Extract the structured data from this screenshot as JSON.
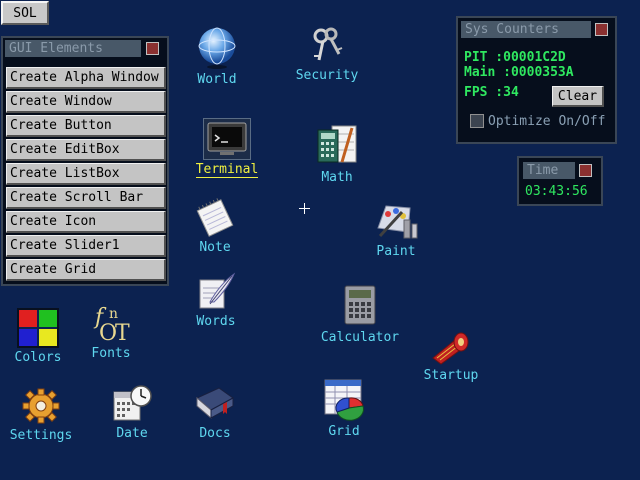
{
  "start_button": {
    "label": "SOL"
  },
  "gui_window": {
    "title": "GUI Elements",
    "items": [
      {
        "label": "Create Alpha Window"
      },
      {
        "label": "Create Window"
      },
      {
        "label": "Create Button"
      },
      {
        "label": "Create EditBox"
      },
      {
        "label": "Create ListBox"
      },
      {
        "label": "Create Scroll Bar"
      },
      {
        "label": "Create Icon"
      },
      {
        "label": "Create Slider1"
      },
      {
        "label": "Create Grid"
      }
    ]
  },
  "sys_counters": {
    "title": "Sys Counters",
    "pit": "PIT  :00001C2D",
    "main": "Main :0000353A",
    "fps": "FPS  :34",
    "clear_label": "Clear",
    "optimize_label": "Optimize On/Off"
  },
  "time_window": {
    "title": "Time",
    "value": "03:43:56"
  },
  "icons": {
    "world": "World",
    "security": "Security",
    "terminal": "Terminal",
    "math": "Math",
    "note": "Note",
    "paint": "Paint",
    "words": "Words",
    "calculator": "Calculator",
    "startup": "Startup",
    "colors": "Colors",
    "fonts": "Fonts",
    "settings": "Settings",
    "date": "Date",
    "docs": "Docs",
    "grid": "Grid"
  }
}
